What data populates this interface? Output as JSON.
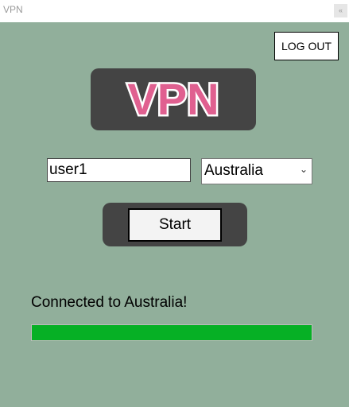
{
  "window": {
    "title": "VPN",
    "control_glyph": "«"
  },
  "header": {
    "logout_label": "LOG OUT"
  },
  "logo": {
    "text": "VPN",
    "color": "#e06090"
  },
  "form": {
    "username_value": "user1",
    "country_selected": "Australia"
  },
  "actions": {
    "start_label": "Start"
  },
  "status": {
    "message": "Connected to Australia!"
  },
  "progress": {
    "value_percent": 100,
    "color": "#06b025"
  },
  "colors": {
    "background": "#91af9b",
    "panel": "#444444"
  }
}
